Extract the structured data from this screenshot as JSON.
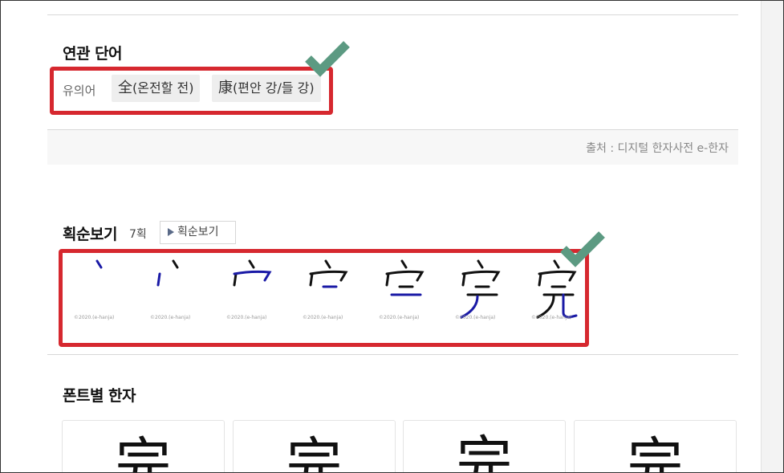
{
  "related": {
    "title": "연관 단어",
    "synonym_label": "유의어",
    "chips": [
      {
        "hanja": "全",
        "meaning": "(온전할 전)"
      },
      {
        "hanja": "康",
        "meaning": "(편안 강/들 강)"
      }
    ]
  },
  "source": {
    "text": "출처 : 디지털 한자사전 e-한자"
  },
  "stroke": {
    "title": "획순보기",
    "count": "7획",
    "button_label": "획순보기",
    "copyright": "©2020.(e-hanja)",
    "frames": 7
  },
  "fonts": {
    "title": "폰트별 한자",
    "char": "完"
  },
  "colors": {
    "highlight": "#d6282f",
    "check": "#5c9a82",
    "stroke_new": "#1a1aa6",
    "stroke_done": "#111111"
  }
}
